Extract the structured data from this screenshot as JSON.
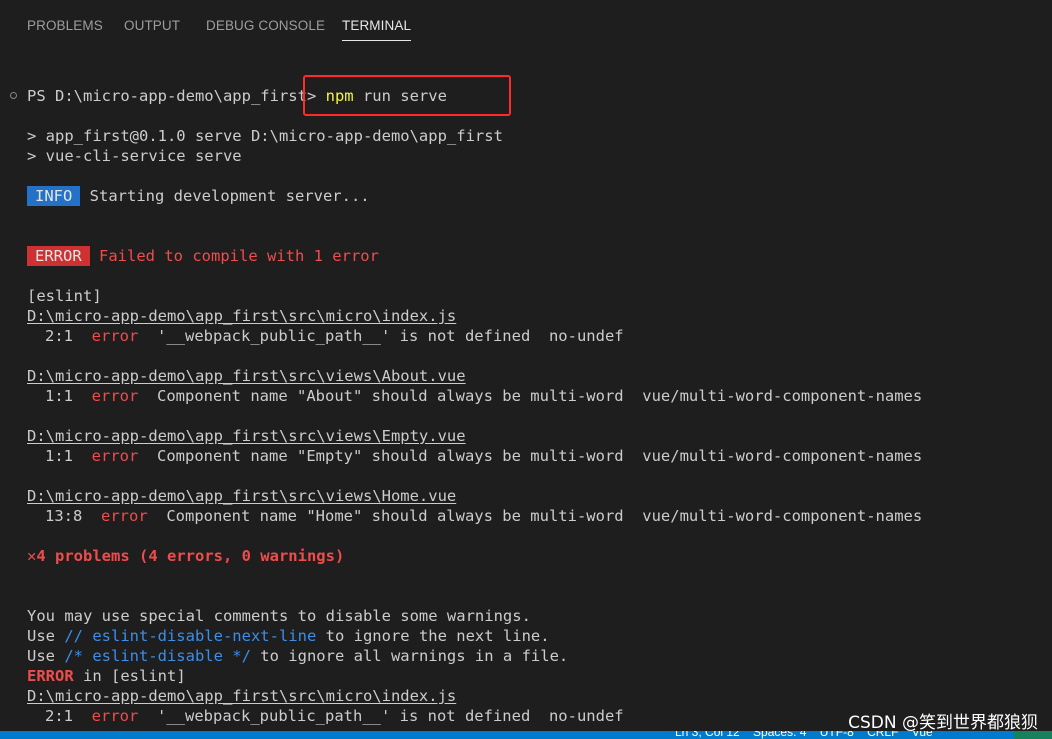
{
  "panel_tabs": [
    {
      "label": "PROBLEMS"
    },
    {
      "label": "OUTPUT"
    },
    {
      "label": "DEBUG CONSOLE"
    },
    {
      "label": "TERMINAL",
      "active": true
    }
  ],
  "terminal": {
    "prompt": "PS D:\\micro-app-demo\\app_first>",
    "cmd_npm": "npm",
    "cmd_rest": " run serve",
    "script_line1": "> app_first@0.1.0 serve D:\\micro-app-demo\\app_first",
    "script_line2": "> vue-cli-service serve",
    "info_badge": "INFO",
    "info_text": "Starting development server...",
    "error_badge": "ERROR",
    "error_text": "Failed to compile with 1 error",
    "eslint_tag": "[eslint]",
    "issues": [
      {
        "file": "D:\\micro-app-demo\\app_first\\src\\micro\\index.js",
        "pos": "2:1",
        "level": "error",
        "message": "'__webpack_public_path__' is not defined  no-undef"
      },
      {
        "file": "D:\\micro-app-demo\\app_first\\src\\views\\About.vue",
        "pos": "1:1",
        "level": "error",
        "message": "Component name \"About\" should always be multi-word  vue/multi-word-component-names"
      },
      {
        "file": "D:\\micro-app-demo\\app_first\\src\\views\\Empty.vue",
        "pos": "1:1",
        "level": "error",
        "message": "Component name \"Empty\" should always be multi-word  vue/multi-word-component-names"
      },
      {
        "file": "D:\\micro-app-demo\\app_first\\src\\views\\Home.vue",
        "pos": "13:8",
        "level": "error",
        "message": "Component name \"Home\" should always be multi-word  vue/multi-word-component-names"
      }
    ],
    "summary_icon": "x-icon",
    "summary": "4 problems (4 errors, 0 warnings)",
    "hint1": "You may use special comments to disable some warnings.",
    "hint2_pre": "Use ",
    "hint2_code": "// eslint-disable-next-line",
    "hint2_post": " to ignore the next line.",
    "hint3_pre": "Use ",
    "hint3_code": "/* eslint-disable */",
    "hint3_post": " to ignore all warnings in a file.",
    "error2_label": "ERROR",
    "error2_rest": " in [eslint]",
    "error2_file": "D:\\micro-app-demo\\app_first\\src\\micro\\index.js",
    "error2_pos": "2:1",
    "error2_level": "error",
    "error2_message": "'__webpack_public_path__' is not defined  no-undef"
  },
  "watermark": "CSDN @笑到世界都狼狈",
  "statusbar": {
    "text": "Ln 3, Col 12    Spaces: 4    UTF-8    CRLF    Vue"
  },
  "colors": {
    "background": "#1e1e1e",
    "error": "#f14c4c",
    "info_badge": "#2472c8",
    "error_badge": "#cd3131",
    "command": "#f5f543",
    "code_hint": "#3b8eea",
    "statusbar": "#007acc",
    "highlight": "#ff2a2a"
  }
}
